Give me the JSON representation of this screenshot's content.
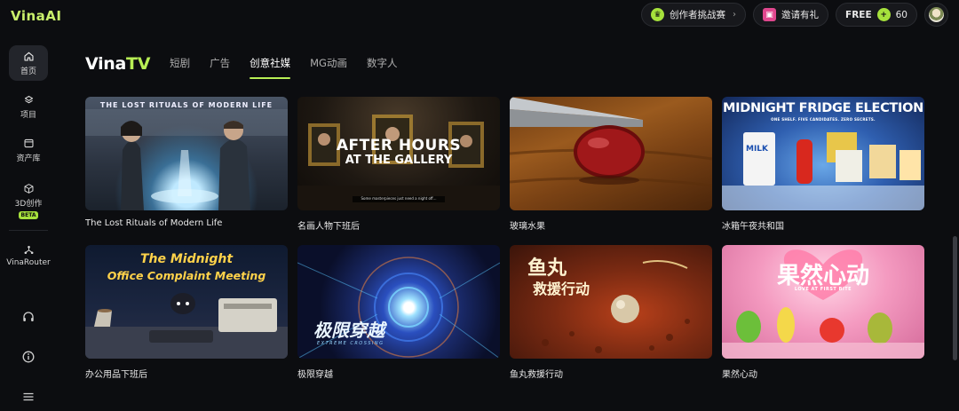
{
  "app": {
    "logo": "VinaAI"
  },
  "topbar": {
    "challenge_label": "创作者挑战赛",
    "invite_label": "邀请有礼",
    "plan_label": "FREE",
    "credits": "60"
  },
  "sidebar": {
    "items": [
      {
        "label": "首页",
        "icon": "home-icon"
      },
      {
        "label": "项目",
        "icon": "project-icon"
      },
      {
        "label": "资产库",
        "icon": "assets-icon"
      },
      {
        "label": "3D创作",
        "icon": "cube-icon",
        "badge": "BETA"
      },
      {
        "label": "VinaRouter",
        "icon": "router-icon"
      }
    ],
    "bottom_icons": [
      "headset-icon",
      "info-icon",
      "menu-icon"
    ]
  },
  "main": {
    "brand": {
      "part1": "Vina",
      "part2": "TV"
    },
    "tabs": [
      {
        "label": "短剧"
      },
      {
        "label": "广告"
      },
      {
        "label": "创意社媒"
      },
      {
        "label": "MG动画"
      },
      {
        "label": "数字人"
      }
    ],
    "active_tab": "创意社媒",
    "cards": [
      {
        "title": "The Lost Rituals of Modern Life",
        "thumb_text": "THE LOST RITUALS OF MODERN LIFE"
      },
      {
        "title": "名画人物下班后",
        "thumb_text_1": "AFTER HOURS",
        "thumb_text_2": "AT THE GALLERY",
        "thumb_caption": "Some masterpieces just need a night off..."
      },
      {
        "title": "玻璃水果"
      },
      {
        "title": "冰箱午夜共和国",
        "thumb_text": "MIDNIGHT FRIDGE ELECTION",
        "thumb_sub": "ONE SHELF. FIVE CANDIDATES. ZERO SECRETS.",
        "thumb_label": "MILK"
      },
      {
        "title": "办公用品下班后",
        "thumb_text_1": "The Midnight",
        "thumb_text_2": "Office Complaint Meeting"
      },
      {
        "title": "极限穿越",
        "thumb_text": "极限穿越",
        "thumb_sub": "EXTREME CROSSING"
      },
      {
        "title": "鱼丸救援行动",
        "thumb_text_1": "鱼丸",
        "thumb_text_2": "救援行动"
      },
      {
        "title": "果然心动",
        "thumb_text": "果然心动",
        "thumb_sub": "LOVE AT FIRST BITE"
      }
    ]
  },
  "colors": {
    "accent": "#b8ef55",
    "background": "#0c0d10"
  }
}
